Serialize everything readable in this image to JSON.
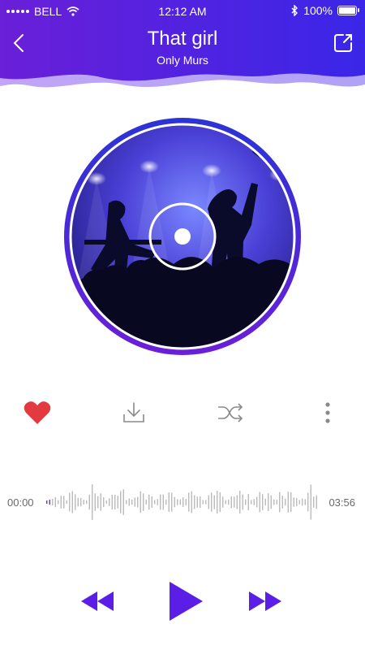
{
  "status_bar": {
    "carrier": "BELL",
    "time": "12:12 AM",
    "battery": "100%"
  },
  "header": {
    "title": "That girl",
    "artist": "Only Murs"
  },
  "colors": {
    "accent": "#5b1ee6",
    "header_start": "#6a1fd8",
    "header_end": "#3a26e8",
    "heart": "#e23a3e"
  },
  "icons": {
    "back": "back-arrow-icon",
    "share": "share-icon",
    "like": "heart-icon",
    "download": "download-icon",
    "shuffle": "shuffle-icon",
    "more": "more-vertical-icon",
    "rewind": "rewind-icon",
    "play": "play-icon",
    "forward": "fast-forward-icon"
  },
  "player": {
    "elapsed": "00:00",
    "duration": "03:56",
    "liked": true
  }
}
